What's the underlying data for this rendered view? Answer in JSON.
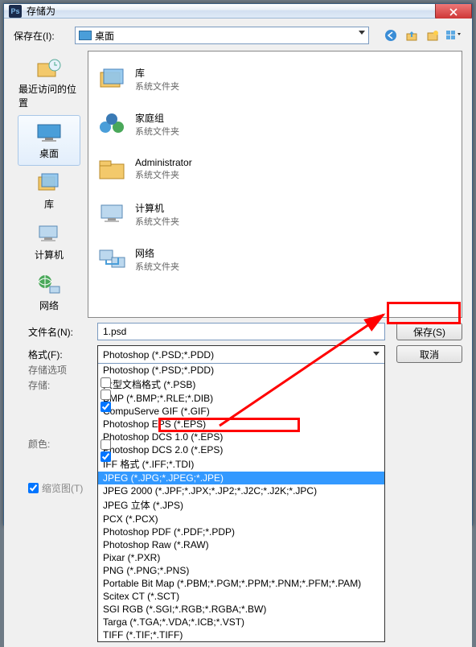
{
  "title": "存储为",
  "savein_label": "保存在(I):",
  "savein_value": "桌面",
  "sidebar": {
    "items": [
      {
        "label": "最近访问的位置"
      },
      {
        "label": "桌面"
      },
      {
        "label": "库"
      },
      {
        "label": "计算机"
      },
      {
        "label": "网络"
      }
    ]
  },
  "list": {
    "items": [
      {
        "name": "库",
        "sub": "系统文件夹"
      },
      {
        "name": "家庭组",
        "sub": "系统文件夹"
      },
      {
        "name": "Administrator",
        "sub": "系统文件夹"
      },
      {
        "name": "计算机",
        "sub": "系统文件夹"
      },
      {
        "name": "网络",
        "sub": "系统文件夹"
      }
    ]
  },
  "filename_label": "文件名(N):",
  "filename_value": "1.psd",
  "format_label": "格式(F):",
  "format_selected": "Photoshop (*.PSD;*.PDD)",
  "format_options": [
    "Photoshop (*.PSD;*.PDD)",
    "大型文档格式 (*.PSB)",
    "BMP (*.BMP;*.RLE;*.DIB)",
    "CompuServe GIF (*.GIF)",
    "Photoshop EPS (*.EPS)",
    "Photoshop DCS 1.0 (*.EPS)",
    "Photoshop DCS 2.0 (*.EPS)",
    "IFF 格式 (*.IFF;*.TDI)",
    "JPEG (*.JPG;*.JPEG;*.JPE)",
    "JPEG 2000 (*.JPF;*.JPX;*.JP2;*.J2C;*.J2K;*.JPC)",
    "JPEG 立体 (*.JPS)",
    "PCX (*.PCX)",
    "Photoshop PDF (*.PDF;*.PDP)",
    "Photoshop Raw (*.RAW)",
    "Pixar (*.PXR)",
    "PNG (*.PNG;*.PNS)",
    "Portable Bit Map (*.PBM;*.PGM;*.PPM;*.PNM;*.PFM;*.PAM)",
    "Scitex CT (*.SCT)",
    "SGI RGB (*.SGI;*.RGB;*.RGBA;*.BW)",
    "Targa (*.TGA;*.VDA;*.ICB;*.VST)",
    "TIFF (*.TIF;*.TIFF)"
  ],
  "format_highlight_index": 8,
  "save_btn": "保存(S)",
  "cancel_btn": "取消",
  "opts": {
    "header": "存储选项",
    "store": "存储:",
    "color": "颜色:",
    "thumbnail": "缩览图(T)"
  }
}
